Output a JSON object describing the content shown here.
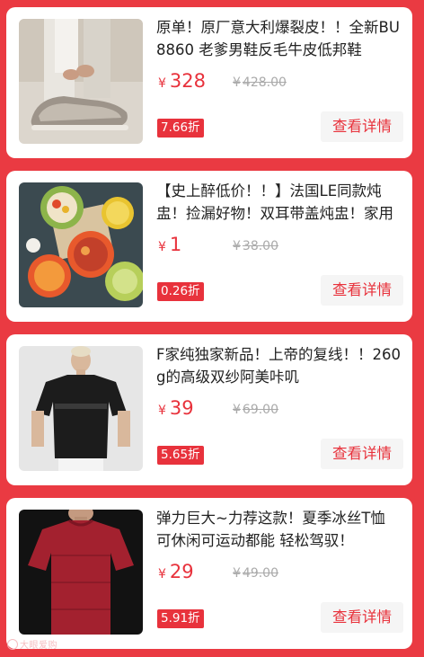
{
  "products": [
    {
      "title": "原单！原厂意大利爆裂皮！！全新BU 8860 老爹男鞋反毛牛皮低邦鞋",
      "currency": "¥",
      "price": "328",
      "original_price": "428.00",
      "discount": "7.66折",
      "button": "查看详情",
      "image": "sneakers-photo"
    },
    {
      "title": "【史上醉低价！！】法国LE同款炖盅！捡漏好物！双耳带盖炖盅！家用",
      "currency": "¥",
      "price": "1",
      "original_price": "38.00",
      "discount": "0.26折",
      "button": "查看详情",
      "image": "ceramic-bowls-photo"
    },
    {
      "title": "F家纯独家新品！上帝的复线！！260g的高级双纱阿美咔叽",
      "currency": "¥",
      "price": "39",
      "original_price": "69.00",
      "discount": "5.65折",
      "button": "查看详情",
      "image": "black-tshirt-photo"
    },
    {
      "title": "弹力巨大~力荐这款！夏季冰丝T恤 可休闲可运动都能 轻松驾驭！",
      "currency": "¥",
      "price": "29",
      "original_price": "49.00",
      "discount": "5.91折",
      "button": "查看详情",
      "image": "red-tshirt-photo"
    }
  ],
  "watermark": "大眼爱购",
  "colors": {
    "background": "#ea3a42",
    "accent": "#e8323c",
    "card": "#ffffff"
  }
}
